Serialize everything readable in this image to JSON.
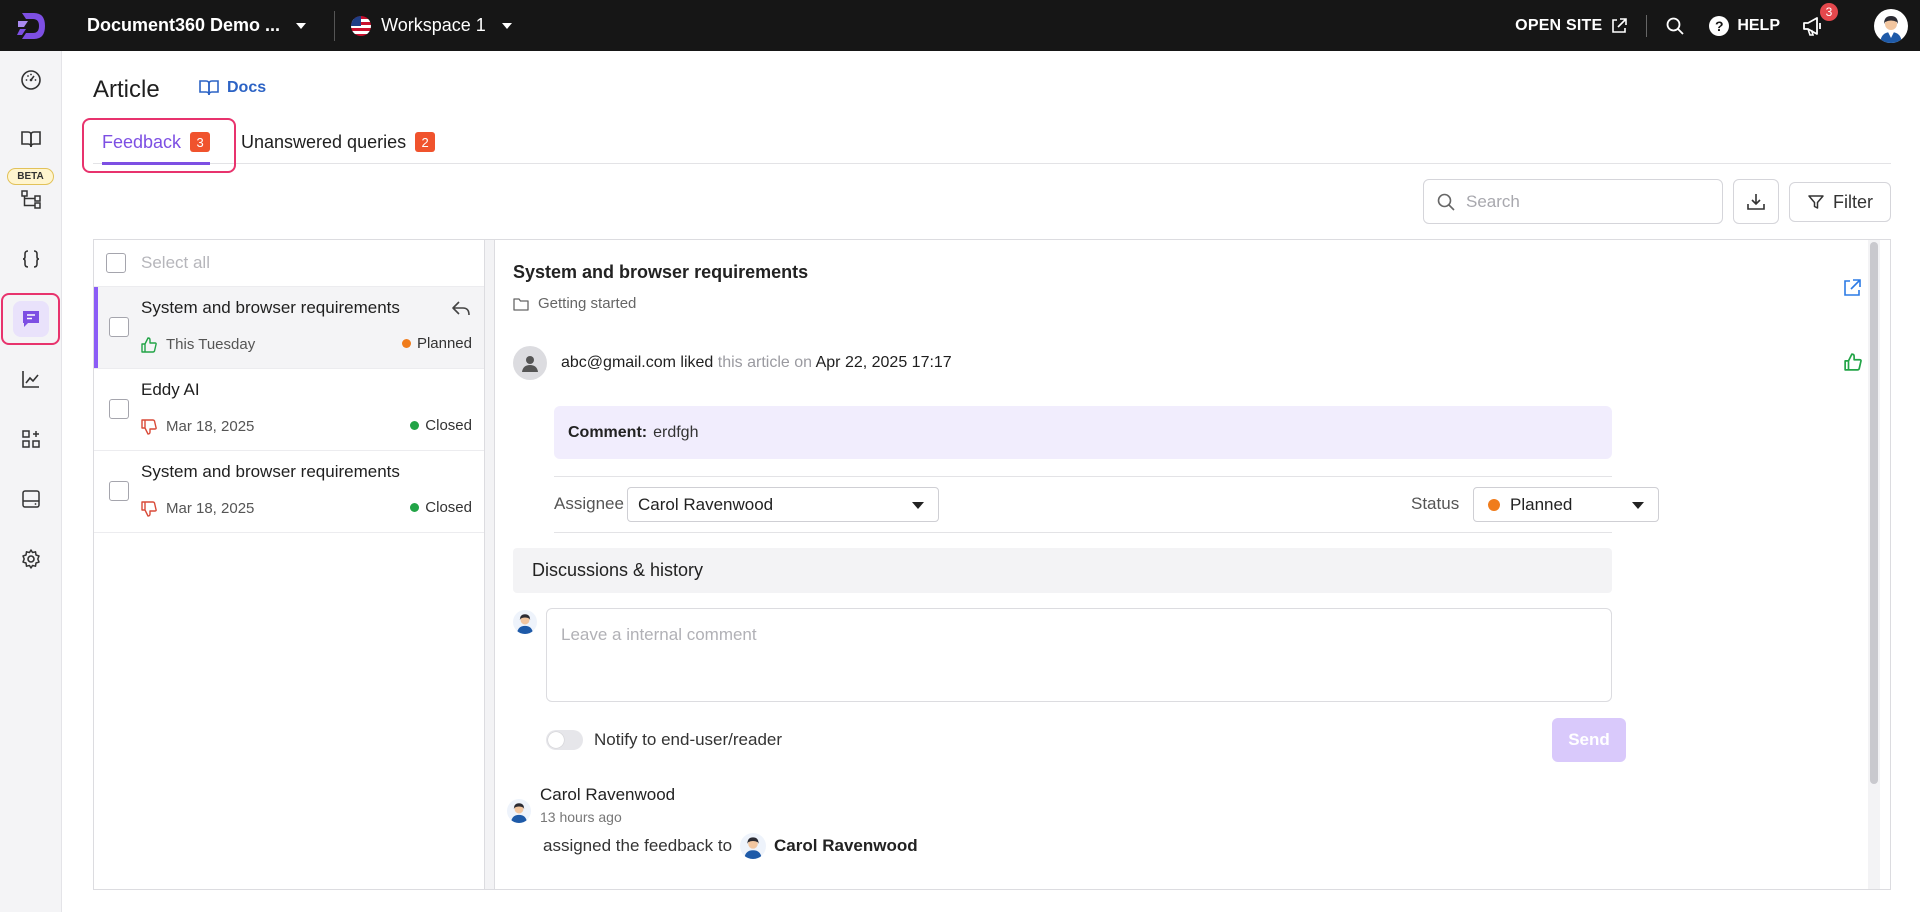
{
  "topbar": {
    "project_name": "Document360 Demo ...",
    "workspace_name": "Workspace 1",
    "open_site_label": "OPEN SITE",
    "help_label": "HELP",
    "notification_count": "3"
  },
  "sidebar": {
    "beta_label": "BETA",
    "items": [
      {
        "icon": "dashboard-icon"
      },
      {
        "icon": "book-icon"
      },
      {
        "icon": "hierarchy-icon"
      },
      {
        "icon": "braces-icon"
      },
      {
        "icon": "feedback-icon",
        "active": true
      },
      {
        "icon": "analytics-icon"
      },
      {
        "icon": "apps-icon"
      },
      {
        "icon": "drive-icon"
      },
      {
        "icon": "settings-icon"
      }
    ]
  },
  "page": {
    "title": "Article",
    "docs_link": "Docs"
  },
  "tabs": [
    {
      "label": "Feedback",
      "count": "3",
      "active": true
    },
    {
      "label": "Unanswered queries",
      "count": "2",
      "active": false
    }
  ],
  "toolbar": {
    "search_placeholder": "Search",
    "filter_label": "Filter"
  },
  "list": {
    "select_all_label": "Select all",
    "items": [
      {
        "title": "System and browser requirements",
        "date": "This Tuesday",
        "status": "Planned",
        "status_color": "#f07c1c",
        "reaction": "like",
        "selected": true
      },
      {
        "title": "Eddy AI",
        "date": "Mar 18, 2025",
        "status": "Closed",
        "status_color": "#22a447",
        "reaction": "dislike",
        "selected": false
      },
      {
        "title": "System and browser requirements",
        "date": "Mar 18, 2025",
        "status": "Closed",
        "status_color": "#22a447",
        "reaction": "dislike",
        "selected": false
      }
    ]
  },
  "detail": {
    "title": "System and browser requirements",
    "category": "Getting started",
    "user_email": "abc@gmail.com",
    "action": "liked",
    "action_mid": "this article on",
    "action_date": "Apr 22, 2025 17:17",
    "comment_label": "Comment:",
    "comment_text": "erdfgh",
    "assignee_label": "Assignee",
    "assignee_value": "Carol Ravenwood",
    "status_label": "Status",
    "status_value": "Planned",
    "status_color": "#f07c1c",
    "discussions_label": "Discussions & history",
    "comment_placeholder": "Leave a internal comment",
    "notify_label": "Notify to end-user/reader",
    "send_label": "Send",
    "history": {
      "name": "Carol Ravenwood",
      "time": "13 hours ago",
      "text": "assigned the feedback to",
      "target": "Carol Ravenwood"
    }
  },
  "colors": {
    "accent": "#7d4fe3",
    "highlight": "#e8336d",
    "badge": "#f0532d",
    "like": "#22a447",
    "dislike": "#d94a38"
  }
}
